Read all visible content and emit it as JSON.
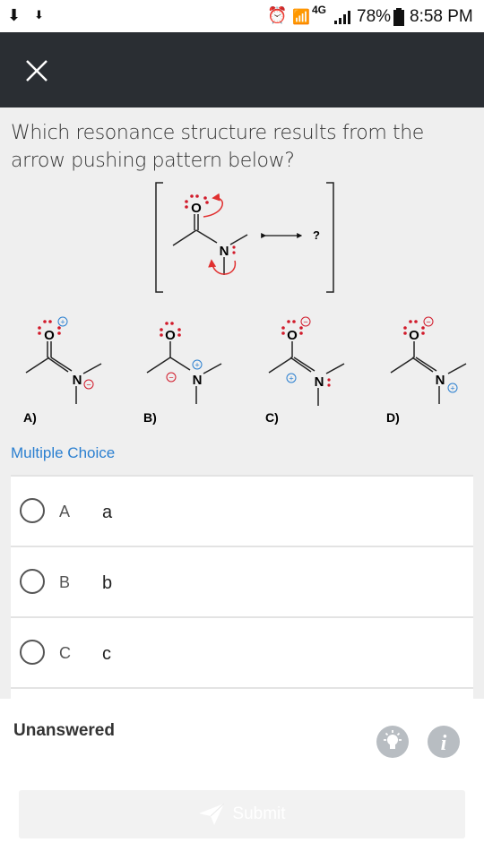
{
  "status_bar": {
    "network": "4G",
    "battery": "78%",
    "time": "8:58 PM",
    "icons": [
      "download-icon",
      "download-small-icon",
      "alarm-icon",
      "wifi-icon",
      "signal-icon",
      "battery-icon"
    ]
  },
  "header": {
    "close_icon": "close-icon"
  },
  "question": {
    "text": "Which resonance structure results from the arrow pushing pattern below?"
  },
  "figure": {
    "reaction_question_mark": "?",
    "atom_o": "O",
    "atom_n": "N",
    "option_labels": [
      "A)",
      "B)",
      "C)",
      "D)"
    ],
    "plus_sign": "+",
    "minus_sign": "−",
    "arrow_color": "#e03030",
    "electron_color": "#d11a2a"
  },
  "section": {
    "multiple_choice_label": "Multiple Choice"
  },
  "choices": [
    {
      "letter": "A",
      "text": "a"
    },
    {
      "letter": "B",
      "text": "b"
    },
    {
      "letter": "C",
      "text": "c"
    }
  ],
  "footer": {
    "status": "Unanswered",
    "hint_icon": "lightbulb-icon",
    "info_icon": "info-icon",
    "info_glyph": "i",
    "submit_label": "Submit",
    "submit_icon": "send-icon"
  },
  "colors": {
    "accent": "#2a7fd0",
    "app_bar": "#2a2e33",
    "disabled": "#f2f2f2"
  }
}
